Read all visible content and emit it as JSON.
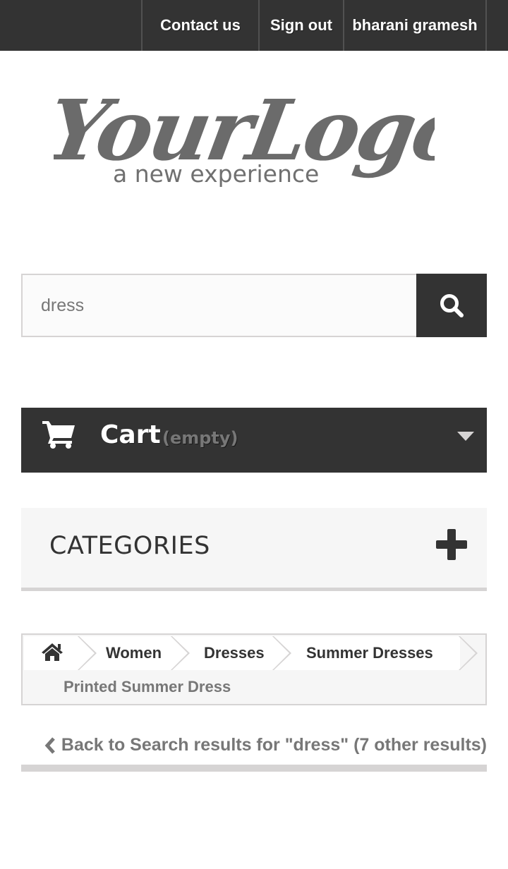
{
  "header": {
    "nav": {
      "contact_label": "Contact us",
      "signout_label": "Sign out",
      "user_name": "bharani gramesh"
    },
    "logo": {
      "text_main": "YourLogo",
      "text_sub": "a new experience"
    }
  },
  "search": {
    "value": "dress",
    "button_icon": "search-icon"
  },
  "cart": {
    "label": "Cart",
    "status": "(empty)",
    "icon": "cart-icon"
  },
  "categories": {
    "title": "CATEGORIES",
    "toggle_icon": "plus-icon"
  },
  "breadcrumb": {
    "home_icon": "home-icon",
    "items": [
      "Women",
      "Dresses",
      "Summer Dresses"
    ],
    "current": "Printed Summer Dress"
  },
  "back_link": {
    "label": "Back to Search results for \"dress\" (7 other results)"
  },
  "colors": {
    "dark": "#333333",
    "muted_text": "#777777",
    "light_bg": "#f6f6f6",
    "border": "#d6d4d4"
  }
}
